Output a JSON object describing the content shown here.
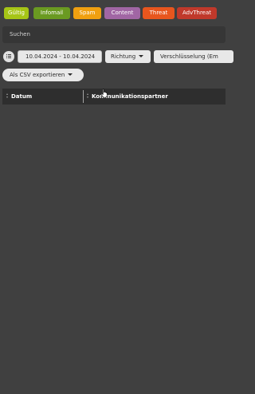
{
  "tags": [
    {
      "label": "Gültig",
      "color": "#a6c516"
    },
    {
      "label": "Infomail",
      "color": "#6a9a21"
    },
    {
      "label": "Spam",
      "color": "#f0a010"
    },
    {
      "label": "Content",
      "color": "#a166a4"
    },
    {
      "label": "Threat",
      "color": "#e8561e"
    },
    {
      "label": "AdvThreat",
      "color": "#c0392b"
    }
  ],
  "search": {
    "placeholder": "Suchen"
  },
  "filters": {
    "date_range": "10.04.2024 - 10.04.2024",
    "direction_label": "Richtung",
    "encryption_label": "Verschlüsselung (Em"
  },
  "export": {
    "label": "Als CSV exportieren"
  },
  "table": {
    "columns": [
      "Datum",
      "Kommunikationspartner"
    ]
  }
}
